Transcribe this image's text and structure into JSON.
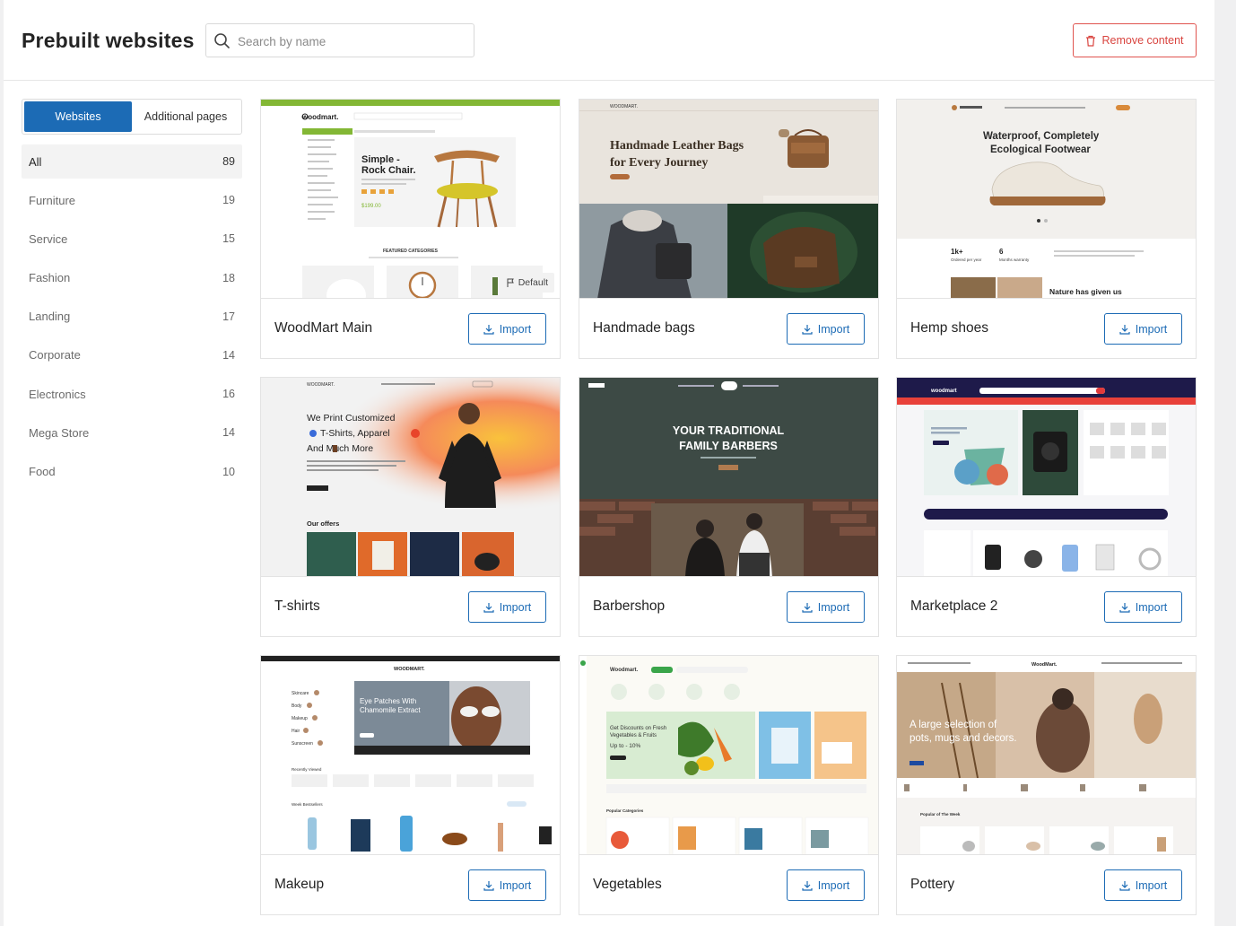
{
  "header": {
    "title": "Prebuilt websites",
    "search_placeholder": "Search by name",
    "remove_label": "Remove content"
  },
  "tabs": [
    {
      "label": "Websites",
      "active": true
    },
    {
      "label": "Additional pages",
      "active": false
    }
  ],
  "categories": [
    {
      "label": "All",
      "count": "89",
      "active": true
    },
    {
      "label": "Furniture",
      "count": "19"
    },
    {
      "label": "Service",
      "count": "15"
    },
    {
      "label": "Fashion",
      "count": "18"
    },
    {
      "label": "Landing",
      "count": "17"
    },
    {
      "label": "Corporate",
      "count": "14"
    },
    {
      "label": "Electronics",
      "count": "16"
    },
    {
      "label": "Mega Store",
      "count": "14"
    },
    {
      "label": "Food",
      "count": "10"
    }
  ],
  "import_label": "Import",
  "default_badge": "Default",
  "cards": [
    {
      "name": "WoodMart Main",
      "thumb": {
        "brand": "woodmart.",
        "headline_1": "Simple -",
        "headline_2": "Rock Chair.",
        "price": "$199.00",
        "section": "FEATURED CATEGORIES"
      }
    },
    {
      "name": "Handmade bags",
      "thumb": {
        "brand": "WOODMART.",
        "headline_1": "Handmade Leather Bags",
        "headline_2": "for Every Journey"
      }
    },
    {
      "name": "Hemp shoes",
      "thumb": {
        "headline_1": "Waterproof, Completely",
        "headline_2": "Ecological Footwear",
        "stat_1": "1k+",
        "stat_1_label": "Ordered per year",
        "stat_2": "6",
        "stat_2_label": "Months warranty",
        "footer_text": "Nature has given us"
      }
    },
    {
      "name": "T-shirts",
      "thumb": {
        "brand": "WOODMART.",
        "headline_1": "We Print Customized",
        "headline_2": "T-Shirts, Apparel",
        "headline_3": "And Much More",
        "section": "Our offers"
      }
    },
    {
      "name": "Barbershop",
      "thumb": {
        "headline_1": "YOUR TRADITIONAL",
        "headline_2": "FAMILY BARBERS"
      }
    },
    {
      "name": "Marketplace 2",
      "thumb": {
        "brand": "woodmart"
      }
    },
    {
      "name": "Makeup",
      "thumb": {
        "brand": "WOODMART.",
        "headline_1": "Eye Patches With",
        "headline_2": "Chamomile Extract",
        "menu": [
          "Skincare",
          "Body",
          "Makeup",
          "Hair",
          "Sunscreen"
        ],
        "section_1": "Recently Viewed",
        "section_2": "Week Bestsellers"
      }
    },
    {
      "name": "Vegetables",
      "thumb": {
        "brand": "Woodmart.",
        "headline_1": "Get Discounts on Fresh",
        "headline_2": "Vegetables & Fruits",
        "promo": "Up to - 10%",
        "section": "Popular Categories"
      }
    },
    {
      "name": "Pottery",
      "thumb": {
        "brand": "WoodMart.",
        "headline_1": "A large selection of",
        "headline_2": "pots, mugs and decors.",
        "section": "Popular of The Week"
      }
    }
  ]
}
